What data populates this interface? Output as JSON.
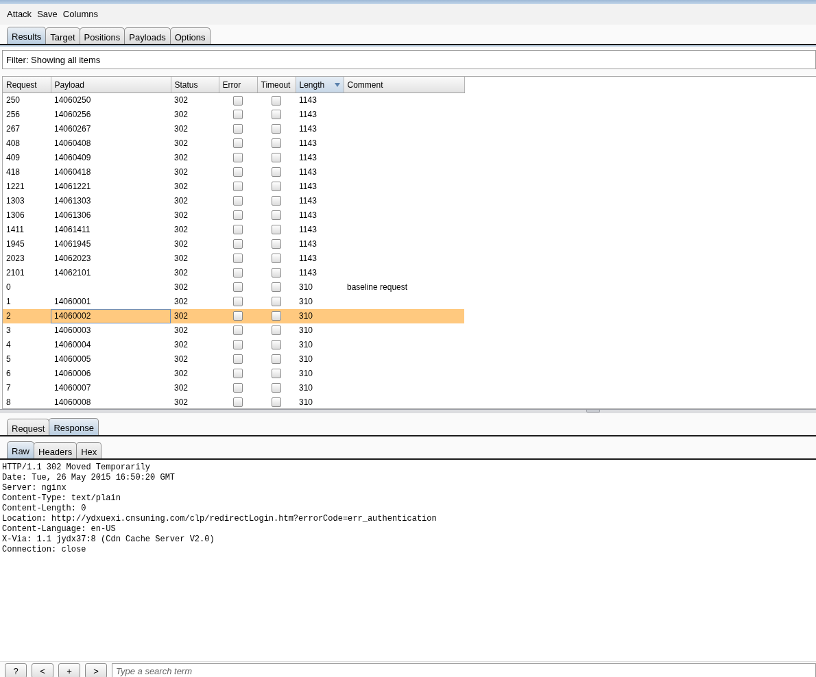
{
  "menu": [
    "Attack",
    "Save",
    "Columns"
  ],
  "tabs": [
    {
      "label": "Results",
      "selected": true
    },
    {
      "label": "Target",
      "selected": false
    },
    {
      "label": "Positions",
      "selected": false
    },
    {
      "label": "Payloads",
      "selected": false
    },
    {
      "label": "Options",
      "selected": false
    }
  ],
  "filter": "Filter: Showing all items",
  "table": {
    "columns": [
      {
        "label": "Request",
        "sorted": false
      },
      {
        "label": "Payload",
        "sorted": false
      },
      {
        "label": "Status",
        "sorted": false
      },
      {
        "label": "Error",
        "sorted": false
      },
      {
        "label": "Timeout",
        "sorted": false
      },
      {
        "label": "Length",
        "sorted": true
      },
      {
        "label": "Comment",
        "sorted": false
      }
    ],
    "rows": [
      {
        "request": "250",
        "payload": "14060250",
        "status": "302",
        "error": false,
        "timeout": false,
        "length": "1143",
        "comment": "",
        "selected": false
      },
      {
        "request": "256",
        "payload": "14060256",
        "status": "302",
        "error": false,
        "timeout": false,
        "length": "1143",
        "comment": "",
        "selected": false
      },
      {
        "request": "267",
        "payload": "14060267",
        "status": "302",
        "error": false,
        "timeout": false,
        "length": "1143",
        "comment": "",
        "selected": false
      },
      {
        "request": "408",
        "payload": "14060408",
        "status": "302",
        "error": false,
        "timeout": false,
        "length": "1143",
        "comment": "",
        "selected": false
      },
      {
        "request": "409",
        "payload": "14060409",
        "status": "302",
        "error": false,
        "timeout": false,
        "length": "1143",
        "comment": "",
        "selected": false
      },
      {
        "request": "418",
        "payload": "14060418",
        "status": "302",
        "error": false,
        "timeout": false,
        "length": "1143",
        "comment": "",
        "selected": false
      },
      {
        "request": "1221",
        "payload": "14061221",
        "status": "302",
        "error": false,
        "timeout": false,
        "length": "1143",
        "comment": "",
        "selected": false
      },
      {
        "request": "1303",
        "payload": "14061303",
        "status": "302",
        "error": false,
        "timeout": false,
        "length": "1143",
        "comment": "",
        "selected": false
      },
      {
        "request": "1306",
        "payload": "14061306",
        "status": "302",
        "error": false,
        "timeout": false,
        "length": "1143",
        "comment": "",
        "selected": false
      },
      {
        "request": "1411",
        "payload": "14061411",
        "status": "302",
        "error": false,
        "timeout": false,
        "length": "1143",
        "comment": "",
        "selected": false
      },
      {
        "request": "1945",
        "payload": "14061945",
        "status": "302",
        "error": false,
        "timeout": false,
        "length": "1143",
        "comment": "",
        "selected": false
      },
      {
        "request": "2023",
        "payload": "14062023",
        "status": "302",
        "error": false,
        "timeout": false,
        "length": "1143",
        "comment": "",
        "selected": false
      },
      {
        "request": "2101",
        "payload": "14062101",
        "status": "302",
        "error": false,
        "timeout": false,
        "length": "1143",
        "comment": "",
        "selected": false
      },
      {
        "request": "0",
        "payload": "",
        "status": "302",
        "error": false,
        "timeout": false,
        "length": "310",
        "comment": "baseline request",
        "selected": false
      },
      {
        "request": "1",
        "payload": "14060001",
        "status": "302",
        "error": false,
        "timeout": false,
        "length": "310",
        "comment": "",
        "selected": false
      },
      {
        "request": "2",
        "payload": "14060002",
        "status": "302",
        "error": false,
        "timeout": false,
        "length": "310",
        "comment": "",
        "selected": true
      },
      {
        "request": "3",
        "payload": "14060003",
        "status": "302",
        "error": false,
        "timeout": false,
        "length": "310",
        "comment": "",
        "selected": false
      },
      {
        "request": "4",
        "payload": "14060004",
        "status": "302",
        "error": false,
        "timeout": false,
        "length": "310",
        "comment": "",
        "selected": false
      },
      {
        "request": "5",
        "payload": "14060005",
        "status": "302",
        "error": false,
        "timeout": false,
        "length": "310",
        "comment": "",
        "selected": false
      },
      {
        "request": "6",
        "payload": "14060006",
        "status": "302",
        "error": false,
        "timeout": false,
        "length": "310",
        "comment": "",
        "selected": false
      },
      {
        "request": "7",
        "payload": "14060007",
        "status": "302",
        "error": false,
        "timeout": false,
        "length": "310",
        "comment": "",
        "selected": false
      },
      {
        "request": "8",
        "payload": "14060008",
        "status": "302",
        "error": false,
        "timeout": false,
        "length": "310",
        "comment": "",
        "selected": false
      }
    ]
  },
  "message_tabs": [
    {
      "label": "Request",
      "selected": false
    },
    {
      "label": "Response",
      "selected": true
    }
  ],
  "view_tabs": [
    {
      "label": "Raw",
      "selected": true
    },
    {
      "label": "Headers",
      "selected": false
    },
    {
      "label": "Hex",
      "selected": false
    }
  ],
  "response_lines": [
    "HTTP/1.1 302 Moved Temporarily",
    "Date: Tue, 26 May 2015 16:50:20 GMT",
    "Server: nginx",
    "Content-Type: text/plain",
    "Content-Length: 0",
    "Location: http://ydxuexi.cnsuning.com/clp/redirectLogin.htm?errorCode=err_authentication",
    "Content-Language: en-US",
    "X-Via: 1.1 jydx37:8 (Cdn Cache Server V2.0)",
    "Connection: close"
  ],
  "search_buttons": [
    "?",
    "<",
    "+",
    ">"
  ],
  "search": {
    "placeholder": "Type a search term"
  }
}
